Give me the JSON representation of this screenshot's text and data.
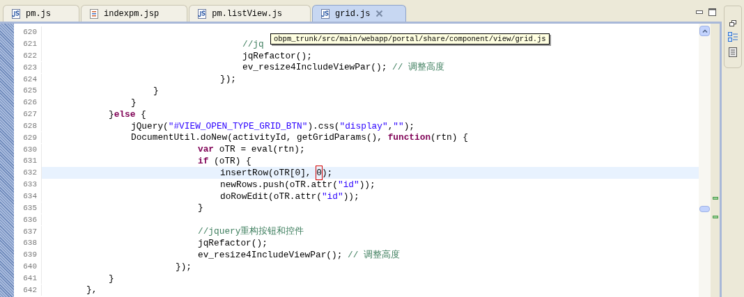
{
  "tabs": [
    {
      "label": "pm.js",
      "kind": "js",
      "selected": false
    },
    {
      "label": "indexpm.jsp",
      "kind": "jsp",
      "selected": false
    },
    {
      "label": "pm.listView.js",
      "kind": "js",
      "selected": false
    },
    {
      "label": "grid.js",
      "kind": "js",
      "selected": true
    }
  ],
  "tooltip": "obpm_trunk/src/main/webapp/portal/share/component/view/grid.js",
  "lines": [
    {
      "number": "620",
      "current": false
    },
    {
      "number": "621",
      "current": false,
      "segments": [
        {
          "kind": "comment",
          "text": "\t\t\t\t\t\t\t\t\t//jq"
        }
      ]
    },
    {
      "number": "622",
      "current": false,
      "segments": [
        {
          "kind": "plain",
          "text": "\t\t\t\t\t\t\t\t\tjqRefactor();"
        }
      ]
    },
    {
      "number": "623",
      "current": false,
      "segments": [
        {
          "kind": "plain",
          "text": "\t\t\t\t\t\t\t\t\tev_resize4IncludeViewPar(); "
        },
        {
          "kind": "comment",
          "text": "// 调整高度"
        }
      ]
    },
    {
      "number": "624",
      "current": false,
      "segments": [
        {
          "kind": "plain",
          "text": "\t\t\t\t\t\t\t\t});"
        }
      ]
    },
    {
      "number": "625",
      "current": false,
      "segments": [
        {
          "kind": "plain",
          "text": "\t\t\t\t\t}"
        }
      ]
    },
    {
      "number": "626",
      "current": false,
      "segments": [
        {
          "kind": "plain",
          "text": "\t\t\t\t}"
        }
      ]
    },
    {
      "number": "627",
      "current": false,
      "segments": [
        {
          "kind": "plain",
          "text": "\t\t\t}"
        },
        {
          "kind": "keyword",
          "text": "else"
        },
        {
          "kind": "plain",
          "text": " {"
        }
      ]
    },
    {
      "number": "628",
      "current": false,
      "segments": [
        {
          "kind": "plain",
          "text": "\t\t\t\tjQuery("
        },
        {
          "kind": "string",
          "text": "\"#VIEW_OPEN_TYPE_GRID_BTN\""
        },
        {
          "kind": "plain",
          "text": ").css("
        },
        {
          "kind": "string",
          "text": "\"display\""
        },
        {
          "kind": "plain",
          "text": ","
        },
        {
          "kind": "string",
          "text": "\"\""
        },
        {
          "kind": "plain",
          "text": ");"
        }
      ]
    },
    {
      "number": "629",
      "current": false,
      "segments": [
        {
          "kind": "plain",
          "text": "\t\t\t\tDocumentUtil.doNew(activityId, getGridParams(), "
        },
        {
          "kind": "keyword",
          "text": "function"
        },
        {
          "kind": "plain",
          "text": "(rtn) {"
        }
      ]
    },
    {
      "number": "630",
      "current": false,
      "segments": [
        {
          "kind": "keyword",
          "text": "\t\t\t\t\t\t\tvar"
        },
        {
          "kind": "plain",
          "text": " oTR = eval(rtn);"
        }
      ]
    },
    {
      "number": "631",
      "current": false,
      "segments": [
        {
          "kind": "keyword",
          "text": "\t\t\t\t\t\t\tif"
        },
        {
          "kind": "plain",
          "text": " (oTR) {"
        }
      ]
    },
    {
      "number": "632",
      "current": true,
      "segments": [
        {
          "kind": "plain",
          "text": "\t\t\t\t\t\t\t\tinsertRow(oTR[0], "
        },
        {
          "kind": "boxed",
          "text": "0"
        },
        {
          "kind": "plain",
          "text": ");"
        }
      ]
    },
    {
      "number": "633",
      "current": false,
      "segments": [
        {
          "kind": "plain",
          "text": "\t\t\t\t\t\t\t\tnewRows.push(oTR.attr("
        },
        {
          "kind": "string",
          "text": "\"id\""
        },
        {
          "kind": "plain",
          "text": "));"
        }
      ]
    },
    {
      "number": "634",
      "current": false,
      "segments": [
        {
          "kind": "plain",
          "text": "\t\t\t\t\t\t\t\tdoRowEdit(oTR.attr("
        },
        {
          "kind": "string",
          "text": "\"id\""
        },
        {
          "kind": "plain",
          "text": "));"
        }
      ]
    },
    {
      "number": "635",
      "current": false,
      "segments": [
        {
          "kind": "plain",
          "text": "\t\t\t\t\t\t\t}"
        }
      ]
    },
    {
      "number": "636",
      "current": false
    },
    {
      "number": "637",
      "current": false,
      "segments": [
        {
          "kind": "comment",
          "text": "\t\t\t\t\t\t\t//jquery重构按钮和控件"
        }
      ]
    },
    {
      "number": "638",
      "current": false,
      "segments": [
        {
          "kind": "plain",
          "text": "\t\t\t\t\t\t\tjqRefactor();"
        }
      ]
    },
    {
      "number": "639",
      "current": false,
      "segments": [
        {
          "kind": "plain",
          "text": "\t\t\t\t\t\t\tev_resize4IncludeViewPar(); "
        },
        {
          "kind": "comment",
          "text": "// 调整高度"
        }
      ]
    },
    {
      "number": "640",
      "current": false,
      "segments": [
        {
          "kind": "plain",
          "text": "\t\t\t\t\t\t});"
        }
      ]
    },
    {
      "number": "641",
      "current": false,
      "segments": [
        {
          "kind": "plain",
          "text": "\t\t\t}"
        }
      ]
    },
    {
      "number": "642",
      "current": false,
      "segments": [
        {
          "kind": "plain",
          "text": "\t\t},"
        }
      ]
    }
  ]
}
